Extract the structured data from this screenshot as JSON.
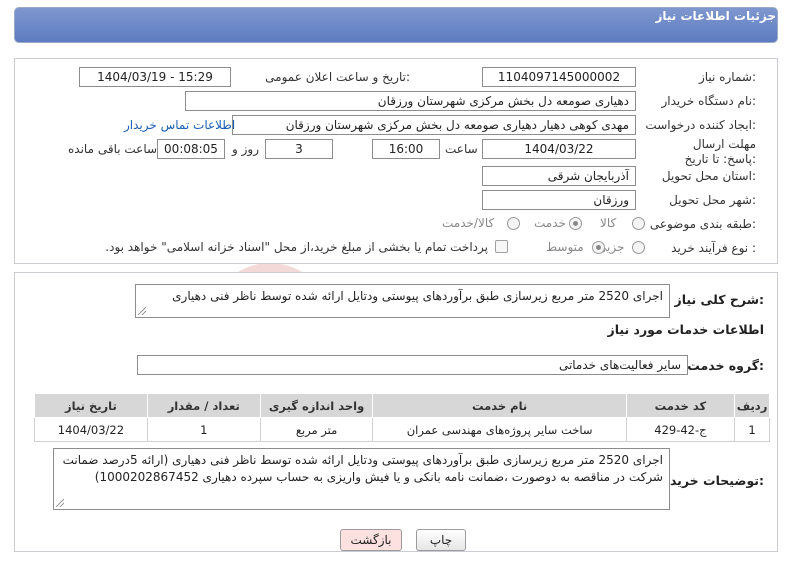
{
  "header": {
    "title": "جزئیات اطلاعات نیاز"
  },
  "form": {
    "need_number": {
      "label": "شماره نیاز:",
      "value": "1104097145000002"
    },
    "announce_datetime": {
      "label": "تاریخ و ساعت اعلان عمومی:",
      "value": "1404/03/19 - 15:29"
    },
    "buyer_org": {
      "label": "نام دستگاه خریدار:",
      "value": "دهیاری صومعه دل بخش مرکزی شهرستان ورزقان"
    },
    "requester": {
      "label": "ایجاد کننده درخواست:",
      "value": "مهدی کوهی دهیار دهیاری صومعه دل بخش مرکزی شهرستان ورزقان",
      "contact_link": "اطلاعات تماس خریدار"
    },
    "deadline": {
      "label": "مهلت ارسال پاسخ: تا تاریخ:",
      "date": "1404/03/22",
      "time_label": "ساعت",
      "time": "16:00",
      "days": "3",
      "days_label": "روز و",
      "remaining": "00:08:05",
      "remaining_label": "ساعت باقی مانده"
    },
    "province": {
      "label": "استان محل تحویل:",
      "value": "آذربایجان شرقی"
    },
    "city": {
      "label": "شهر محل تحویل:",
      "value": "ورزقان"
    },
    "category": {
      "label": "طبقه بندی موضوعی:",
      "options": [
        "کالا",
        "خدمت",
        "کالا/خدمت"
      ],
      "selected": "خدمت"
    },
    "process": {
      "label": "نوع فرآیند خرید :",
      "options": [
        "جزیی",
        "متوسط"
      ],
      "selected": "متوسط",
      "payment_note": "پرداخت تمام یا بخشی از مبلغ خرید،از محل \"اسناد خزانه اسلامی\" خواهد بود."
    }
  },
  "summary": {
    "label": "شرح کلی نیاز:",
    "value": "اجرای 2520 متر مربع زیرسازی طبق برآوردهای پیوستی ودتایل ارائه شده توسط ناظر فنی دهیاری"
  },
  "services": {
    "section_title": "اطلاعات خدمات مورد نیاز",
    "group_label": "گروه خدمت:",
    "group_value": "سایر فعالیت‌های خدماتی",
    "columns": [
      "ردیف",
      "کد خدمت",
      "نام خدمت",
      "واحد اندازه گیری",
      "تعداد / مقدار",
      "تاریخ نیاز"
    ],
    "rows": [
      {
        "row": "1",
        "code": "ج-42-429",
        "name": "ساخت سایر پروژه‌های مهندسی عمران",
        "unit": "متر مربع",
        "qty": "1",
        "date": "1404/03/22"
      }
    ]
  },
  "buyer_notes": {
    "label": "توضیحات خریدار:",
    "value": "اجرای 2520 متر مربع زیرسازی طبق برآوردهای پیوستی ودتایل ارائه شده توسط ناظر فنی دهیاری (ارائه 5درصد ضمانت شرکت در مناقصه به دوصورت ،ضمانت نامه بانکی و یا فیش واریزی به حساب سپرده دهیاری 1000202867452)"
  },
  "actions": {
    "print": "چاپ",
    "back": "بازگشت"
  },
  "colors": {
    "header_bg": "#6a87c6",
    "link": "#1a5fb4",
    "back_btn_bg": "#fde1e1"
  }
}
